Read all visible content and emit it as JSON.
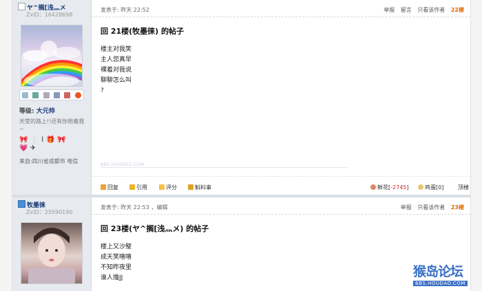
{
  "posts": [
    {
      "username": "ヤ^搁[浅灬メ",
      "zxid": "ZxID：16428698",
      "level_label": "等级:",
      "level_value": "大元帅",
      "signature": "天堂的路上!!还有你陪着我~",
      "medals": "🎀 ❕ ⌇ 🎁 🎀 💗 ✈",
      "location": "来自:四川省成都市 电信",
      "posted": "发表于: 昨天 22:52",
      "header_actions": [
        "举报",
        "留言",
        "只看该作者"
      ],
      "floor": "22楼",
      "title": "回 21楼(牧墨徕) 的帖子",
      "body_lines": [
        "楼主对我笑",
        "主人您真早",
        "裸着对我说",
        "聊聊怎么叫",
        "?"
      ],
      "watermark": "BBS.HOUDAO.COM",
      "footer_actions": [
        "回复",
        "引用",
        "评分",
        "斛料事"
      ],
      "flower_label": "鲜花[",
      "flower_count": "-2745",
      "flower_close": "]",
      "egg_label": "鸡蛋[0]",
      "top_label": "顶楼"
    },
    {
      "username": "牧墨徕",
      "zxid": "ZxID：25590190",
      "posted": "发表于: 昨天 22:53",
      "edit": "，编辑",
      "header_actions": [
        "举报",
        "只看该作者"
      ],
      "floor": "23楼",
      "title": "回 23楼(ヤ^搁[浅灬メ) 的帖子",
      "body_lines": [
        "楼上又沙璧",
        "成天笑嘻嘻",
        "不知昨夜里",
        "谁人撸JJ"
      ]
    }
  ],
  "logo": {
    "main": "猴岛论坛",
    "url": "BBS.HOUDAO.COM"
  },
  "colors": {
    "accent": "#1a3c79",
    "floor": "#e26900",
    "sidebar": "#e7eaef"
  },
  "icons": [
    "user-icon",
    "message-icon",
    "add-friend-icon",
    "search-icon",
    "profile-icon",
    "qq-icon",
    "reply-icon",
    "quote-icon",
    "rate-icon",
    "report-icon",
    "flower-icon",
    "egg-icon"
  ]
}
